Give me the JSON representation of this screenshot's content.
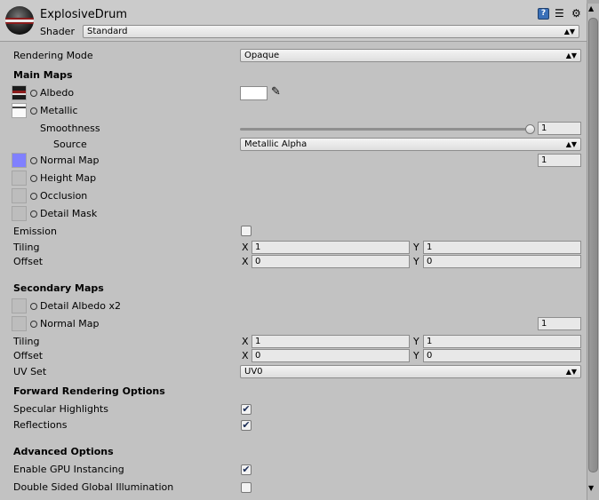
{
  "material": {
    "name": "ExplosiveDrum",
    "shader_label": "Shader",
    "shader_value": "Standard"
  },
  "rendering_mode": {
    "label": "Rendering Mode",
    "value": "Opaque"
  },
  "main_maps": {
    "title": "Main Maps",
    "albedo": {
      "label": "Albedo",
      "color": "#ffffff"
    },
    "metallic": {
      "label": "Metallic"
    },
    "smoothness": {
      "label": "Smoothness",
      "value": "1",
      "fraction": 1.0
    },
    "source": {
      "label": "Source",
      "value": "Metallic Alpha"
    },
    "normal_map": {
      "label": "Normal Map",
      "value": "1"
    },
    "height_map": {
      "label": "Height Map"
    },
    "occlusion": {
      "label": "Occlusion"
    },
    "detail_mask": {
      "label": "Detail Mask"
    },
    "emission": {
      "label": "Emission",
      "checked": false
    },
    "tiling": {
      "label": "Tiling",
      "x_label": "X",
      "x": "1",
      "y_label": "Y",
      "y": "1"
    },
    "offset": {
      "label": "Offset",
      "x_label": "X",
      "x": "0",
      "y_label": "Y",
      "y": "0"
    }
  },
  "secondary_maps": {
    "title": "Secondary Maps",
    "detail_albedo": {
      "label": "Detail Albedo x2"
    },
    "normal_map": {
      "label": "Normal Map",
      "value": "1"
    },
    "tiling": {
      "label": "Tiling",
      "x_label": "X",
      "x": "1",
      "y_label": "Y",
      "y": "1"
    },
    "offset": {
      "label": "Offset",
      "x_label": "X",
      "x": "0",
      "y_label": "Y",
      "y": "0"
    },
    "uv_set": {
      "label": "UV Set",
      "value": "UV0"
    }
  },
  "forward_rendering": {
    "title": "Forward Rendering Options",
    "specular": {
      "label": "Specular Highlights",
      "checked": true
    },
    "reflections": {
      "label": "Reflections",
      "checked": true
    }
  },
  "advanced": {
    "title": "Advanced Options",
    "gpu_instancing": {
      "label": "Enable GPU Instancing",
      "checked": true
    },
    "double_sided_gi": {
      "label": "Double Sided Global Illumination",
      "checked": false
    }
  },
  "glyphs": {
    "dropdown_arrow": "▲▼",
    "check": "✔",
    "help": "?",
    "settings": "⚙",
    "sliders": "☰",
    "eyedropper": "✎",
    "scroll_up": "▲",
    "scroll_down": "▼"
  },
  "colors": {
    "normal_map_tint": "#8080ff",
    "albedo_band": "#8c1c1c"
  }
}
